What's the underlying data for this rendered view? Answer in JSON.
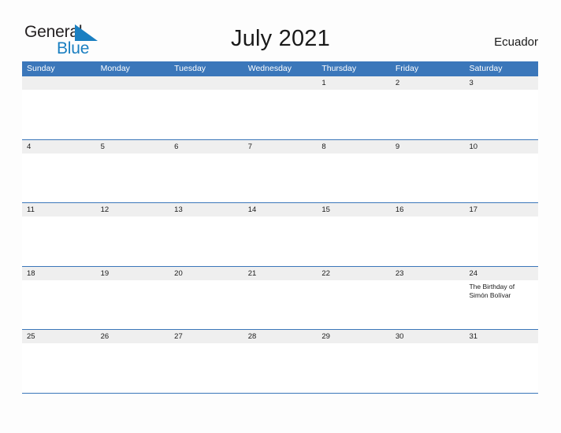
{
  "brand": {
    "name_part1": "General",
    "name_part2": "Blue",
    "flag_icon": "triangle-flag-icon",
    "color_dark": "#231f20",
    "color_blue": "#1a7fc1"
  },
  "header": {
    "title": "July 2021",
    "region": "Ecuador",
    "header_bg_color": "#3b77ba",
    "band_bg_color": "#efefef"
  },
  "weekdays": [
    "Sunday",
    "Monday",
    "Tuesday",
    "Wednesday",
    "Thursday",
    "Friday",
    "Saturday"
  ],
  "weeks": [
    {
      "days": [
        {
          "num": "",
          "event": ""
        },
        {
          "num": "",
          "event": ""
        },
        {
          "num": "",
          "event": ""
        },
        {
          "num": "",
          "event": ""
        },
        {
          "num": "1",
          "event": ""
        },
        {
          "num": "2",
          "event": ""
        },
        {
          "num": "3",
          "event": ""
        }
      ]
    },
    {
      "days": [
        {
          "num": "4",
          "event": ""
        },
        {
          "num": "5",
          "event": ""
        },
        {
          "num": "6",
          "event": ""
        },
        {
          "num": "7",
          "event": ""
        },
        {
          "num": "8",
          "event": ""
        },
        {
          "num": "9",
          "event": ""
        },
        {
          "num": "10",
          "event": ""
        }
      ]
    },
    {
      "days": [
        {
          "num": "11",
          "event": ""
        },
        {
          "num": "12",
          "event": ""
        },
        {
          "num": "13",
          "event": ""
        },
        {
          "num": "14",
          "event": ""
        },
        {
          "num": "15",
          "event": ""
        },
        {
          "num": "16",
          "event": ""
        },
        {
          "num": "17",
          "event": ""
        }
      ]
    },
    {
      "days": [
        {
          "num": "18",
          "event": ""
        },
        {
          "num": "19",
          "event": ""
        },
        {
          "num": "20",
          "event": ""
        },
        {
          "num": "21",
          "event": ""
        },
        {
          "num": "22",
          "event": ""
        },
        {
          "num": "23",
          "event": ""
        },
        {
          "num": "24",
          "event": "The Birthday of Simón Bolívar"
        }
      ]
    },
    {
      "days": [
        {
          "num": "25",
          "event": ""
        },
        {
          "num": "26",
          "event": ""
        },
        {
          "num": "27",
          "event": ""
        },
        {
          "num": "28",
          "event": ""
        },
        {
          "num": "29",
          "event": ""
        },
        {
          "num": "30",
          "event": ""
        },
        {
          "num": "31",
          "event": ""
        }
      ]
    }
  ]
}
